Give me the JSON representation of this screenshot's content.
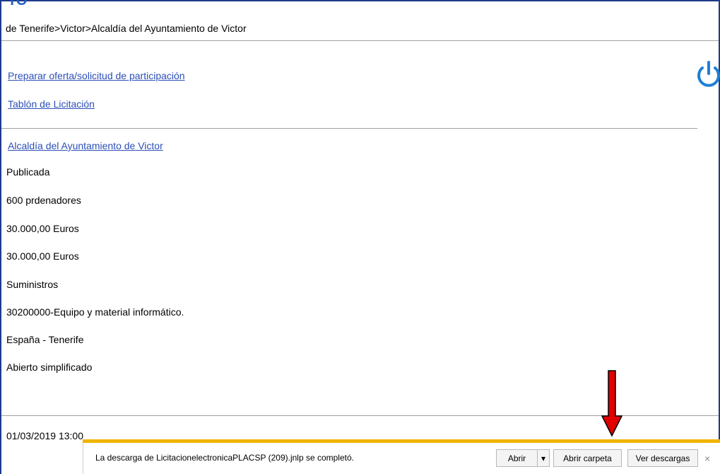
{
  "header": {
    "cut_heading": "TO",
    "breadcrumb": "de Tenerife>Victor>Alcaldía del Ayuntamiento de Victor"
  },
  "links": {
    "prepare_offer": "Preparar oferta/solicitud de participación",
    "tender_board": "Tablón de Licitación",
    "organization": "Alcaldía del Ayuntamiento de Victor"
  },
  "fields": [
    "Publicada",
    "600 prdenadores",
    "30.000,00  Euros",
    "30.000,00  Euros",
    "Suministros",
    "30200000-Equipo y material informático.",
    "España - Tenerife",
    "Abierto simplificado"
  ],
  "date": "01/03/2019 13:00",
  "download_bar": {
    "message": "La descarga de LicitacionelectronicaPLACSP (209).jnlp se completó.",
    "open_label": "Abrir",
    "open_arrow": "▾",
    "open_folder_label": "Abrir carpeta",
    "view_downloads_label": "Ver descargas",
    "close_glyph": "×"
  },
  "colors": {
    "link": "#2c4fb8",
    "power_icon": "#1e7fd6",
    "arrow": "#e00000",
    "download_bar_accent": "#f0b400"
  },
  "icons": {
    "power": "power-icon",
    "annotation_arrow": "arrow-down-icon"
  }
}
